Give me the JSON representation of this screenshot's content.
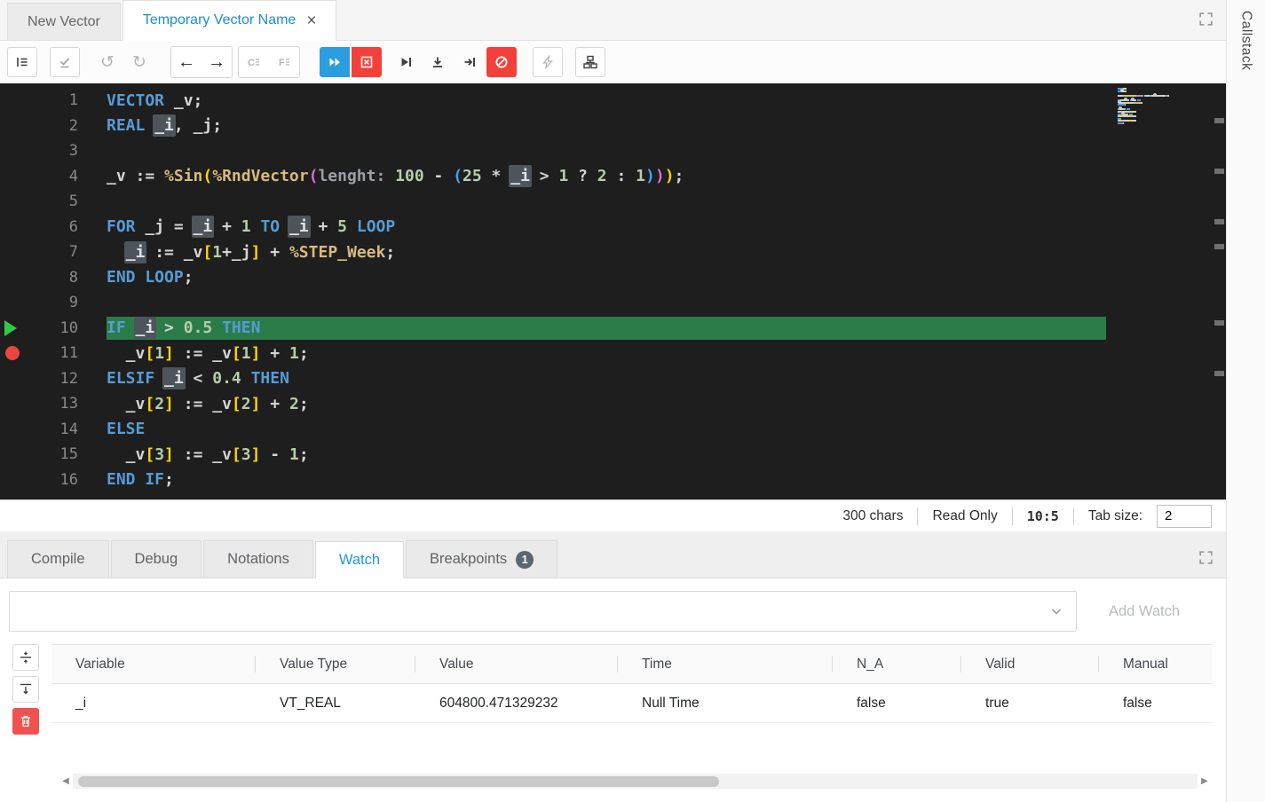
{
  "tabs": {
    "inactive": {
      "label": "New Vector"
    },
    "active": {
      "label": "Temporary Vector Name",
      "close": "×"
    }
  },
  "callstack_label": "Callstack",
  "icons": {
    "undo": "↺",
    "redo": "↻",
    "back": "←",
    "forward": "→",
    "scroll_left": "◀",
    "scroll_right": "▶"
  },
  "colors": {
    "accent_blue": "#2196d8",
    "run_blue": "#2b9ee0",
    "danger_red": "#f4403a",
    "editor_background": "#1e1e1e",
    "current_line_green": "#2c7c49",
    "breakpoint_red": "#e8453c",
    "current_statement_green": "#2fca4a"
  },
  "status": {
    "chars": "300 chars",
    "mode": "Read Only",
    "caret": "10:5",
    "tab_size_label": "Tab size:",
    "tab_size_value": "2"
  },
  "panel": {
    "tabs": [
      {
        "label": "Compile"
      },
      {
        "label": "Debug"
      },
      {
        "label": "Notations"
      },
      {
        "label": "Watch",
        "active": true
      },
      {
        "label": "Breakpoints",
        "badge": "1"
      }
    ]
  },
  "watch": {
    "input_value": "",
    "add_button_label": "Add Watch",
    "columns": [
      "Variable",
      "Value Type",
      "Value",
      "Time",
      "N_A",
      "Valid",
      "Manual"
    ],
    "rows": [
      [
        "_i",
        "VT_REAL",
        "604800.471329232",
        "Null Time",
        "false",
        "true",
        "false"
      ]
    ]
  },
  "editor": {
    "current_line": 10,
    "breakpoint_line": 11,
    "lines": [
      {
        "num": 1,
        "tokens": [
          {
            "t": "VECTOR",
            "c": "kw"
          },
          {
            "t": " _v;",
            "c": "pl"
          }
        ]
      },
      {
        "num": 2,
        "tokens": [
          {
            "t": "REAL",
            "c": "kw"
          },
          {
            "t": " ",
            "c": "pl"
          },
          {
            "t": "_i",
            "c": "sel"
          },
          {
            "t": ", _j;",
            "c": "pl"
          }
        ]
      },
      {
        "num": 3,
        "tokens": []
      },
      {
        "num": 4,
        "tokens": [
          {
            "t": "_v := ",
            "c": "pl"
          },
          {
            "t": "%Sin",
            "c": "fn"
          },
          {
            "t": "(",
            "c": "b1"
          },
          {
            "t": "%RndVector",
            "c": "fn"
          },
          {
            "t": "(",
            "c": "b2"
          },
          {
            "t": "lenght:",
            "c": "param"
          },
          {
            "t": " ",
            "c": "pl"
          },
          {
            "t": "100",
            "c": "num"
          },
          {
            "t": " - ",
            "c": "pl"
          },
          {
            "t": "(",
            "c": "b3"
          },
          {
            "t": "25",
            "c": "num"
          },
          {
            "t": " * ",
            "c": "pl"
          },
          {
            "t": "_i",
            "c": "sel"
          },
          {
            "t": " > ",
            "c": "pl"
          },
          {
            "t": "1",
            "c": "num"
          },
          {
            "t": " ? ",
            "c": "pl"
          },
          {
            "t": "2",
            "c": "num"
          },
          {
            "t": " : ",
            "c": "pl"
          },
          {
            "t": "1",
            "c": "num"
          },
          {
            "t": ")",
            "c": "b3"
          },
          {
            "t": ")",
            "c": "b2"
          },
          {
            "t": ")",
            "c": "b1"
          },
          {
            "t": ";",
            "c": "pl"
          }
        ]
      },
      {
        "num": 5,
        "tokens": []
      },
      {
        "num": 6,
        "tokens": [
          {
            "t": "FOR",
            "c": "kw"
          },
          {
            "t": " _j = ",
            "c": "pl"
          },
          {
            "t": "_i",
            "c": "sel"
          },
          {
            "t": " + ",
            "c": "pl"
          },
          {
            "t": "1",
            "c": "num"
          },
          {
            "t": " ",
            "c": "pl"
          },
          {
            "t": "TO",
            "c": "kw"
          },
          {
            "t": " ",
            "c": "pl"
          },
          {
            "t": "_i",
            "c": "sel"
          },
          {
            "t": " + ",
            "c": "pl"
          },
          {
            "t": "5",
            "c": "num"
          },
          {
            "t": " ",
            "c": "pl"
          },
          {
            "t": "LOOP",
            "c": "kw"
          }
        ]
      },
      {
        "num": 7,
        "tokens": [
          {
            "t": "  ",
            "c": "pl"
          },
          {
            "t": "_i",
            "c": "sel"
          },
          {
            "t": " := _v",
            "c": "pl"
          },
          {
            "t": "[",
            "c": "b1"
          },
          {
            "t": "1",
            "c": "num"
          },
          {
            "t": "+_j",
            "c": "pl"
          },
          {
            "t": "]",
            "c": "b1"
          },
          {
            "t": " + ",
            "c": "pl"
          },
          {
            "t": "%STEP_Week",
            "c": "fn"
          },
          {
            "t": ";",
            "c": "pl"
          }
        ]
      },
      {
        "num": 8,
        "tokens": [
          {
            "t": "END LOOP",
            "c": "kw"
          },
          {
            "t": ";",
            "c": "pl"
          }
        ]
      },
      {
        "num": 9,
        "tokens": []
      },
      {
        "num": 10,
        "current": true,
        "tokens": [
          {
            "t": "IF",
            "c": "kw"
          },
          {
            "t": " ",
            "c": "pl"
          },
          {
            "t": "_i",
            "c": "sel"
          },
          {
            "t": " > ",
            "c": "pl"
          },
          {
            "t": "0.5",
            "c": "num"
          },
          {
            "t": " ",
            "c": "pl"
          },
          {
            "t": "THEN",
            "c": "kw"
          }
        ]
      },
      {
        "num": 11,
        "breakpoint": true,
        "tokens": [
          {
            "t": "  _v",
            "c": "pl"
          },
          {
            "t": "[",
            "c": "b1"
          },
          {
            "t": "1",
            "c": "num"
          },
          {
            "t": "]",
            "c": "b1"
          },
          {
            "t": " := _v",
            "c": "pl"
          },
          {
            "t": "[",
            "c": "b1"
          },
          {
            "t": "1",
            "c": "num"
          },
          {
            "t": "]",
            "c": "b1"
          },
          {
            "t": " + ",
            "c": "pl"
          },
          {
            "t": "1",
            "c": "num"
          },
          {
            "t": ";",
            "c": "pl"
          }
        ]
      },
      {
        "num": 12,
        "tokens": [
          {
            "t": "ELSIF",
            "c": "kw"
          },
          {
            "t": " ",
            "c": "pl"
          },
          {
            "t": "_i",
            "c": "sel"
          },
          {
            "t": " < ",
            "c": "pl"
          },
          {
            "t": "0.4",
            "c": "num"
          },
          {
            "t": " ",
            "c": "pl"
          },
          {
            "t": "THEN",
            "c": "kw"
          }
        ]
      },
      {
        "num": 13,
        "tokens": [
          {
            "t": "  _v",
            "c": "pl"
          },
          {
            "t": "[",
            "c": "b1"
          },
          {
            "t": "2",
            "c": "num"
          },
          {
            "t": "]",
            "c": "b1"
          },
          {
            "t": " := _v",
            "c": "pl"
          },
          {
            "t": "[",
            "c": "b1"
          },
          {
            "t": "2",
            "c": "num"
          },
          {
            "t": "]",
            "c": "b1"
          },
          {
            "t": " + ",
            "c": "pl"
          },
          {
            "t": "2",
            "c": "num"
          },
          {
            "t": ";",
            "c": "pl"
          }
        ]
      },
      {
        "num": 14,
        "tokens": [
          {
            "t": "ELSE",
            "c": "kw"
          }
        ]
      },
      {
        "num": 15,
        "tokens": [
          {
            "t": "  _v",
            "c": "pl"
          },
          {
            "t": "[",
            "c": "b1"
          },
          {
            "t": "3",
            "c": "num"
          },
          {
            "t": "]",
            "c": "b1"
          },
          {
            "t": " := _v",
            "c": "pl"
          },
          {
            "t": "[",
            "c": "b1"
          },
          {
            "t": "3",
            "c": "num"
          },
          {
            "t": "]",
            "c": "b1"
          },
          {
            "t": " - ",
            "c": "pl"
          },
          {
            "t": "1",
            "c": "num"
          },
          {
            "t": ";",
            "c": "pl"
          }
        ]
      },
      {
        "num": 16,
        "tokens": [
          {
            "t": "END IF",
            "c": "kw"
          },
          {
            "t": ";",
            "c": "pl"
          }
        ]
      }
    ]
  }
}
